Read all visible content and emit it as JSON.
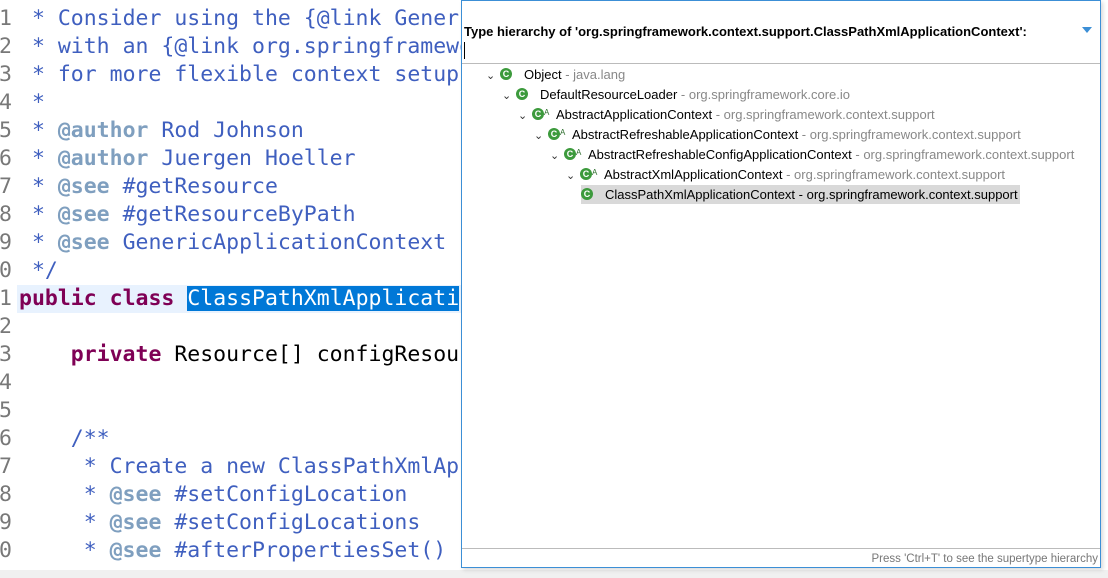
{
  "editor": {
    "line_numbers": [
      "1",
      "2",
      "3",
      "4",
      "5",
      "6",
      "7",
      "8",
      "9",
      "0",
      "1",
      "2",
      "3",
      "4",
      "5",
      "6",
      "7",
      "8",
      "9",
      "0"
    ],
    "lines": [
      [
        {
          "t": " * ",
          "c": "cm"
        },
        {
          "t": "Consider using the {@link GenericApplicationContext} class",
          "c": "cm"
        }
      ],
      [
        {
          "t": " * ",
          "c": "cm"
        },
        {
          "t": "with an {@link org.springframework",
          "c": "cm"
        }
      ],
      [
        {
          "t": " * ",
          "c": "cm"
        },
        {
          "t": "for more flexible context setup",
          "c": "cm"
        }
      ],
      [
        {
          "t": " *",
          "c": "cm"
        }
      ],
      [
        {
          "t": " * ",
          "c": "cm"
        },
        {
          "t": "@author",
          "c": "tag"
        },
        {
          "t": " Rod Johnson",
          "c": "cm"
        }
      ],
      [
        {
          "t": " * ",
          "c": "cm"
        },
        {
          "t": "@author",
          "c": "tag"
        },
        {
          "t": " Juergen Hoeller",
          "c": "cm"
        }
      ],
      [
        {
          "t": " * ",
          "c": "cm"
        },
        {
          "t": "@see",
          "c": "tag"
        },
        {
          "t": " #getResource",
          "c": "cm"
        }
      ],
      [
        {
          "t": " * ",
          "c": "cm"
        },
        {
          "t": "@see",
          "c": "tag"
        },
        {
          "t": " #getResourceByPath",
          "c": "cm"
        }
      ],
      [
        {
          "t": " * ",
          "c": "cm"
        },
        {
          "t": "@see",
          "c": "tag"
        },
        {
          "t": " GenericApplicationContext",
          "c": "cm"
        }
      ],
      [
        {
          "t": " */",
          "c": "cm"
        }
      ],
      [
        {
          "t": "public",
          "c": "kw"
        },
        {
          "t": " "
        },
        {
          "t": "class",
          "c": "kw"
        },
        {
          "t": " "
        },
        {
          "t": "ClassPathXmlApplicati",
          "c": "sel"
        }
      ],
      [],
      [
        {
          "t": "    "
        },
        {
          "t": "private",
          "c": "kw"
        },
        {
          "t": " Resource[] configResou"
        }
      ],
      [],
      [],
      [
        {
          "t": "    /**",
          "c": "cm"
        }
      ],
      [
        {
          "t": "     * Create a new ClassPathXmlAp",
          "c": "cm"
        }
      ],
      [
        {
          "t": "     * ",
          "c": "cm"
        },
        {
          "t": "@see",
          "c": "tag"
        },
        {
          "t": " #setConfigLocation",
          "c": "cm"
        }
      ],
      [
        {
          "t": "     * ",
          "c": "cm"
        },
        {
          "t": "@see",
          "c": "tag"
        },
        {
          "t": " #setConfigLocations",
          "c": "cm"
        }
      ],
      [
        {
          "t": "     * ",
          "c": "cm"
        },
        {
          "t": "@see",
          "c": "tag"
        },
        {
          "t": " #afterPropertiesSet()",
          "c": "cm"
        }
      ]
    ]
  },
  "popup": {
    "title": "Type hierarchy of 'org.springframework.context.support.ClassPathXmlApplicationContext':",
    "filter_value": "",
    "tree": [
      {
        "name": "Object",
        "package": "java.lang",
        "abstract": false
      },
      {
        "name": "DefaultResourceLoader",
        "package": "org.springframework.core.io",
        "abstract": false
      },
      {
        "name": "AbstractApplicationContext",
        "package": "org.springframework.context.support",
        "abstract": true
      },
      {
        "name": "AbstractRefreshableApplicationContext",
        "package": "org.springframework.context.support",
        "abstract": true
      },
      {
        "name": "AbstractRefreshableConfigApplicationContext",
        "package": "org.springframework.context.support",
        "abstract": true
      },
      {
        "name": "AbstractXmlApplicationContext",
        "package": "org.springframework.context.support",
        "abstract": true
      },
      {
        "name": "ClassPathXmlApplicationContext",
        "package": "org.springframework.context.support",
        "abstract": false,
        "selected": true
      }
    ],
    "separator": " - ",
    "hint": "Press 'Ctrl+T' to see the supertype hierarchy",
    "accent": "#3c8fd6"
  }
}
